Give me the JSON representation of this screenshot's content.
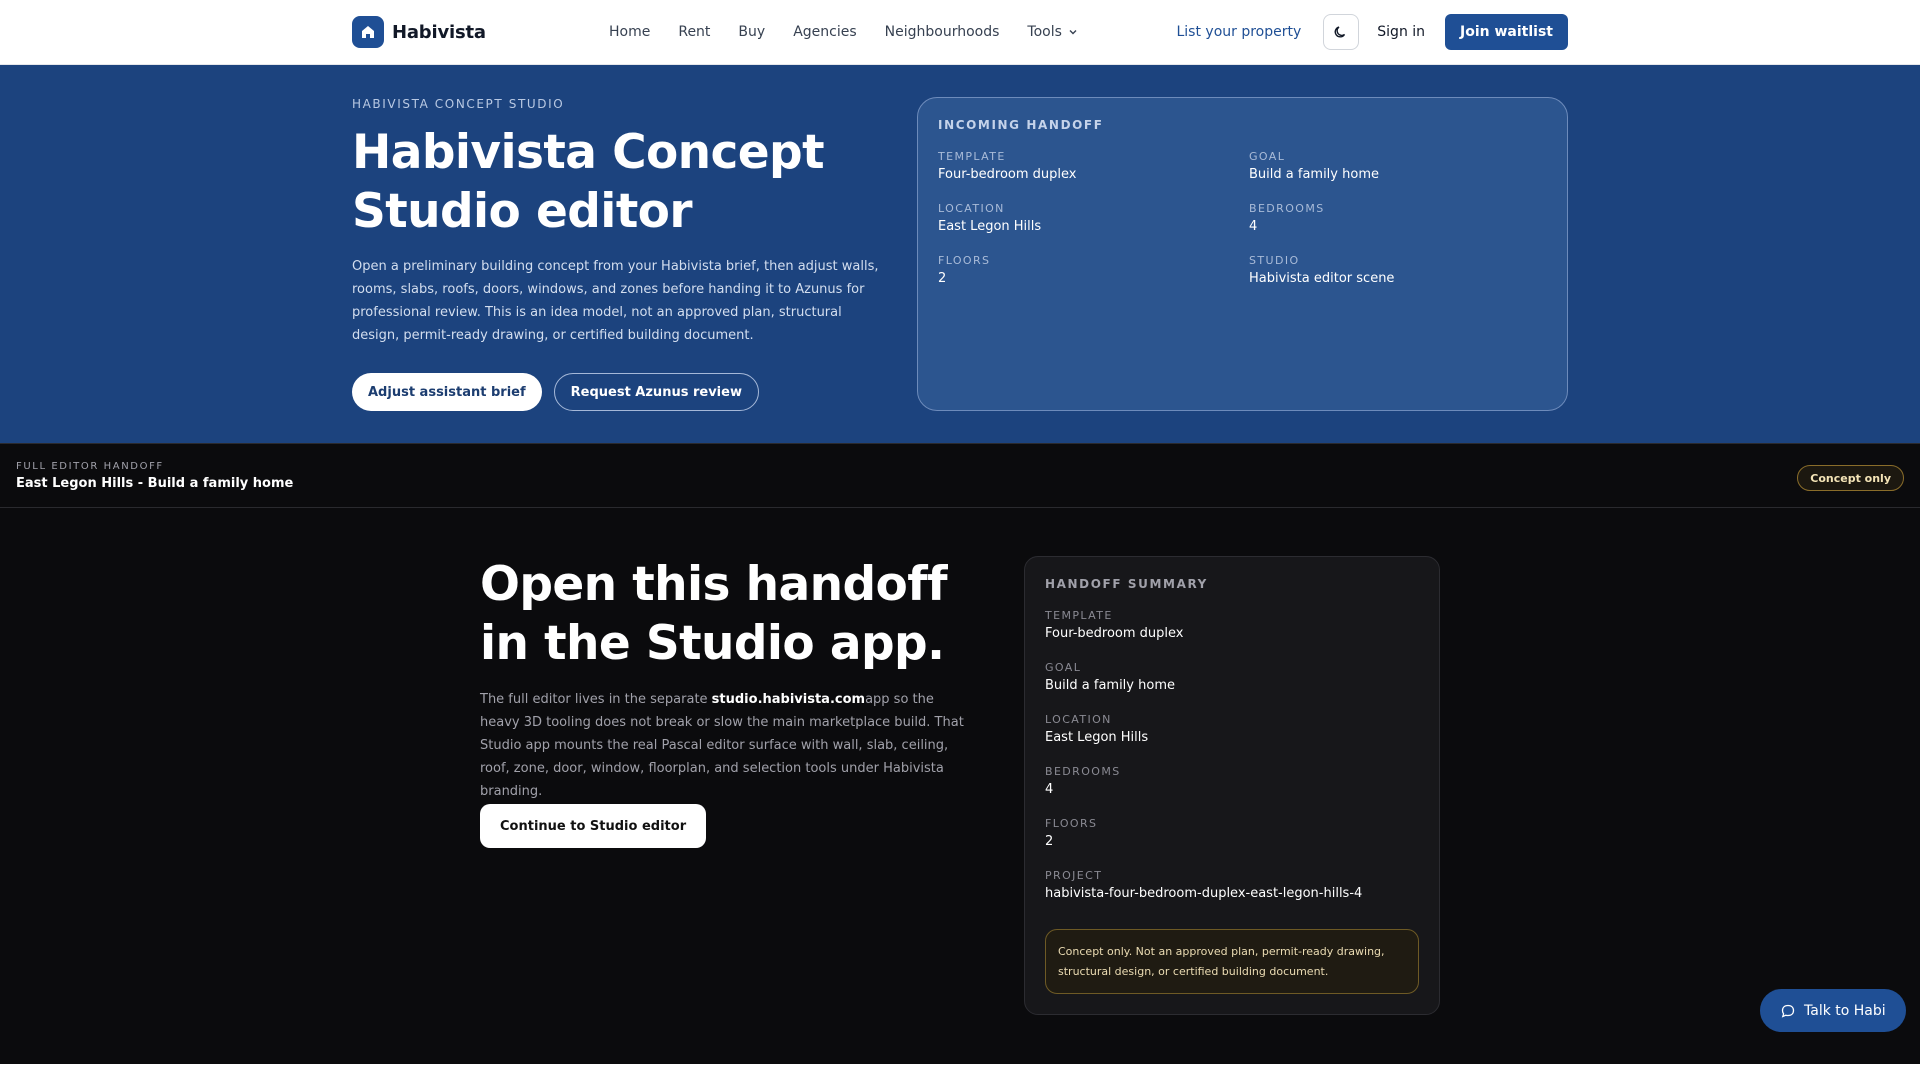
{
  "nav": {
    "brand": "Habivista",
    "links": [
      "Home",
      "Rent",
      "Buy",
      "Agencies",
      "Neighbourhoods"
    ],
    "tools_label": "Tools",
    "list_property": "List your property",
    "sign_in": "Sign in",
    "join": "Join waitlist",
    "icons": {
      "logo": "house-icon",
      "theme": "moon-icon",
      "tools": "chevron-down-icon"
    }
  },
  "hero": {
    "eyebrow": "HABIVISTA CONCEPT STUDIO",
    "title": "Habivista Concept Studio editor",
    "description": "Open a preliminary building concept from your Habivista brief, then adjust walls, rooms, slabs, roofs, doors, windows, and zones before handing it to Azunus for professional review. This is an idea model, not an approved plan, structural design, permit-ready drawing, or certified building document.",
    "btn_primary": "Adjust assistant brief",
    "btn_secondary": "Request Azunus review"
  },
  "incoming": {
    "heading": "INCOMING HANDOFF",
    "fields": [
      {
        "label": "TEMPLATE",
        "value": "Four-bedroom duplex"
      },
      {
        "label": "GOAL",
        "value": "Build a family home"
      },
      {
        "label": "LOCATION",
        "value": "East Legon Hills"
      },
      {
        "label": "BEDROOMS",
        "value": "4"
      },
      {
        "label": "FLOORS",
        "value": "2"
      },
      {
        "label": "STUDIO",
        "value": "Habivista editor scene"
      }
    ]
  },
  "strip": {
    "eyebrow": "FULL EDITOR HANDOFF",
    "title": "East Legon Hills - Build a family home",
    "badge": "Concept only"
  },
  "main": {
    "title": "Open this handoff in the Studio app.",
    "desc_before": "The full editor lives in the separate ",
    "desc_highlight": "studio.habivista.com",
    "desc_after": "app so the heavy 3D tooling does not break or slow the main marketplace build. That Studio app mounts the real Pascal editor surface with wall, slab, ceiling, roof, zone, door, window, floorplan, and selection tools under Habivista branding.",
    "continue": "Continue to Studio editor"
  },
  "summary": {
    "heading": "HANDOFF SUMMARY",
    "fields": [
      {
        "label": "TEMPLATE",
        "value": "Four-bedroom duplex"
      },
      {
        "label": "GOAL",
        "value": "Build a family home"
      },
      {
        "label": "LOCATION",
        "value": "East Legon Hills"
      },
      {
        "label": "BEDROOMS",
        "value": "4"
      },
      {
        "label": "FLOORS",
        "value": "2"
      },
      {
        "label": "PROJECT",
        "value": "habivista-four-bedroom-duplex-east-legon-hills-4"
      }
    ],
    "notice": "Concept only. Not an approved plan, permit-ready drawing, structural design, or certified building document."
  },
  "chat": {
    "label": "Talk to Habi",
    "icon": "chat-bubble-icon"
  },
  "colors": {
    "brand": "#1f4f95",
    "hero_bg": "#1c437e",
    "page_bg": "#0b0b0d"
  }
}
